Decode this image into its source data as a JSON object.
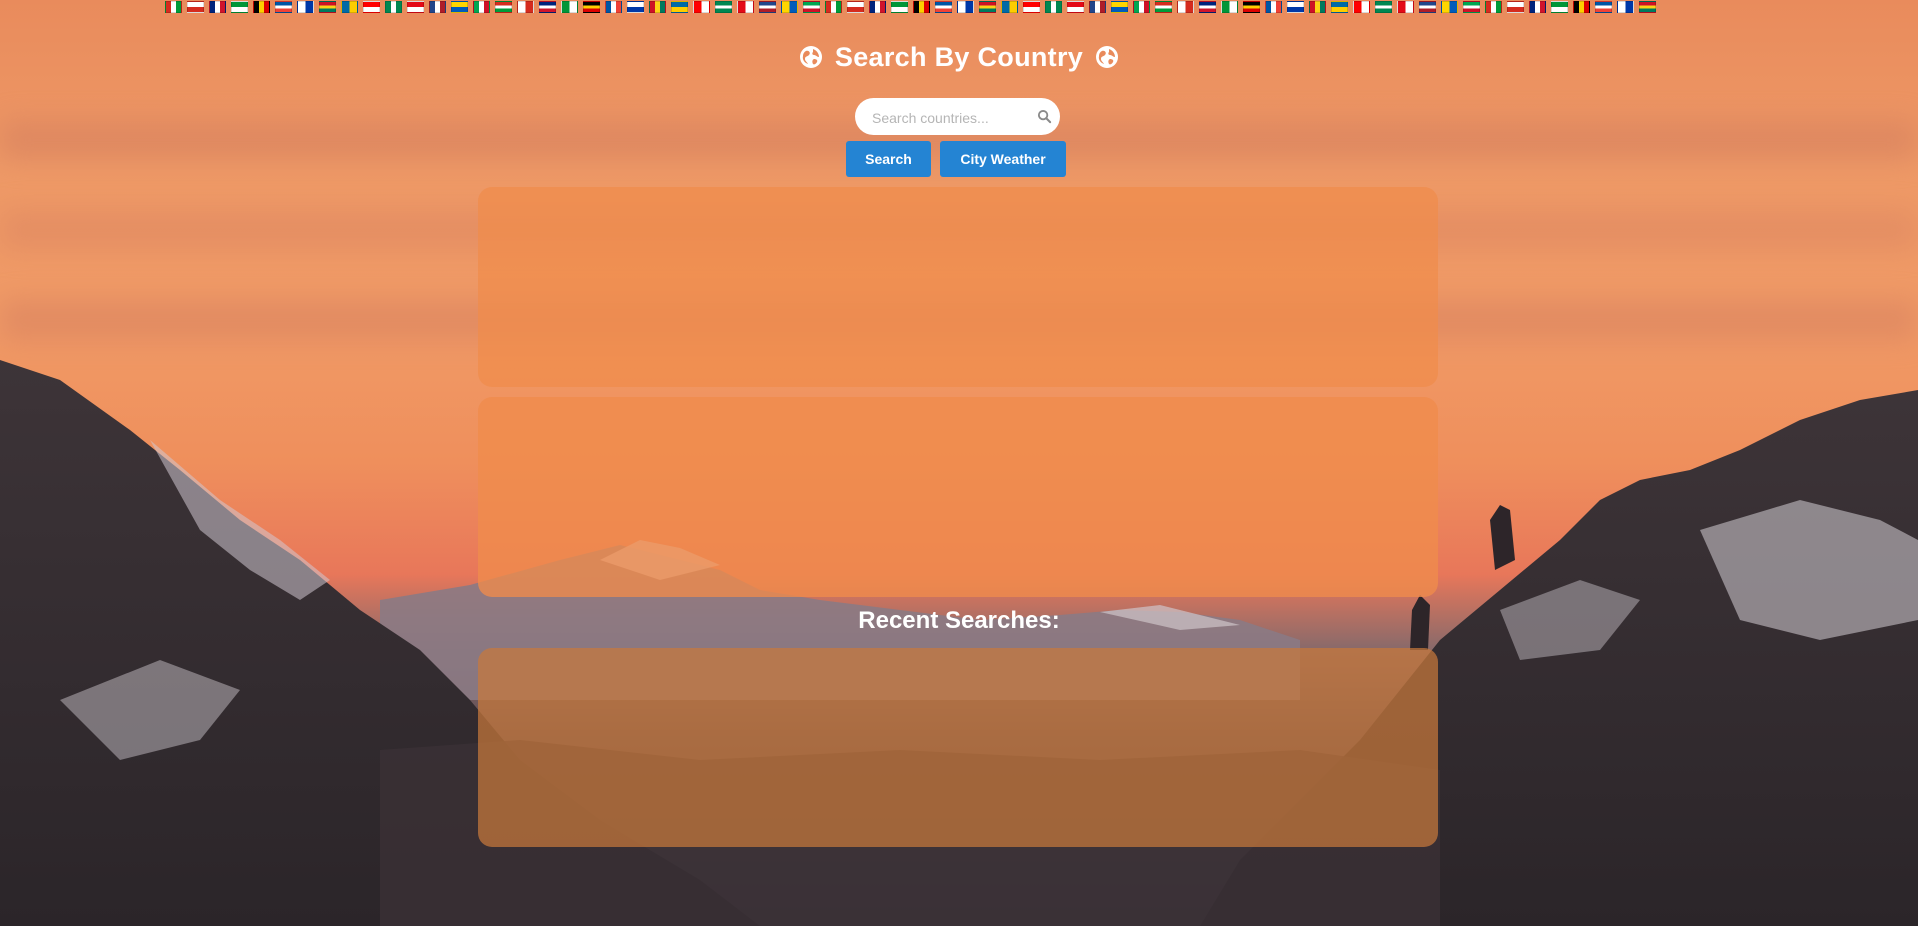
{
  "header": {
    "title": "Search By Country",
    "left_icon": "globe-icon",
    "right_icon": "globe-icon"
  },
  "search": {
    "placeholder": "Search countries...",
    "value": "",
    "icon": "search-icon"
  },
  "buttons": {
    "search_label": "Search",
    "city_weather_label": "City Weather"
  },
  "recent": {
    "title": "Recent Searches:"
  },
  "colors": {
    "button": "#2484d3",
    "panel": "#f08c4b",
    "text": "#ffffff"
  }
}
